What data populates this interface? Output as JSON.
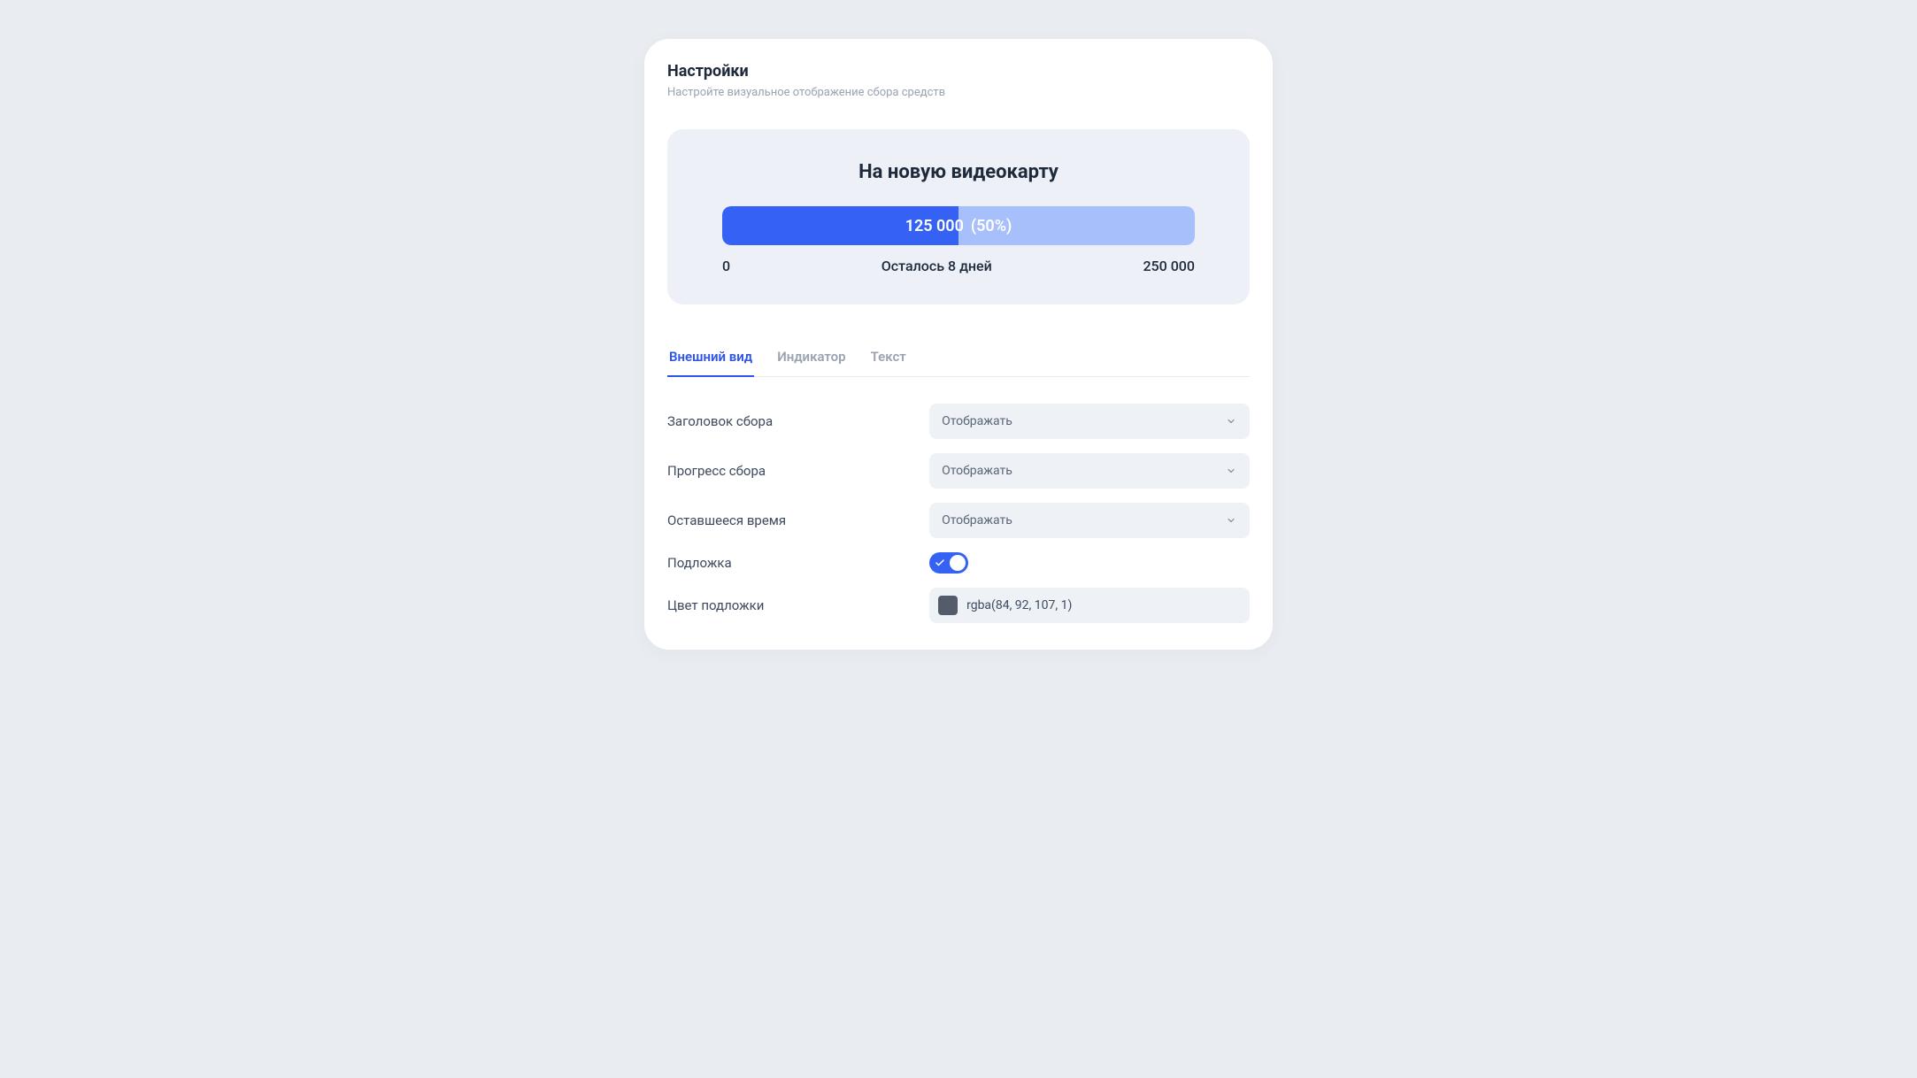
{
  "header": {
    "title": "Настройки",
    "subtitle": "Настройте визуальное отображение сбора средств"
  },
  "preview": {
    "title": "На новую видеокарту",
    "amount": "125 000",
    "percent": "(50%)",
    "progress_pct": 50,
    "min": "0",
    "remaining": "Осталось 8 дней",
    "max": "250 000"
  },
  "tabs": [
    {
      "label": "Внешний вид",
      "active": true
    },
    {
      "label": "Индикатор",
      "active": false
    },
    {
      "label": "Текст",
      "active": false
    }
  ],
  "form": {
    "title_label": "Заголовок сбора",
    "title_value": "Отображать",
    "progress_label": "Прогресс сбора",
    "progress_value": "Отображать",
    "time_label": "Оставшееся время",
    "time_value": "Отображать",
    "backing_label": "Подложка",
    "backing_on": true,
    "backing_color_label": "Цвет подложки",
    "backing_color_value": "rgba(84, 92, 107, 1)",
    "backing_color_swatch": "#545c6b"
  }
}
